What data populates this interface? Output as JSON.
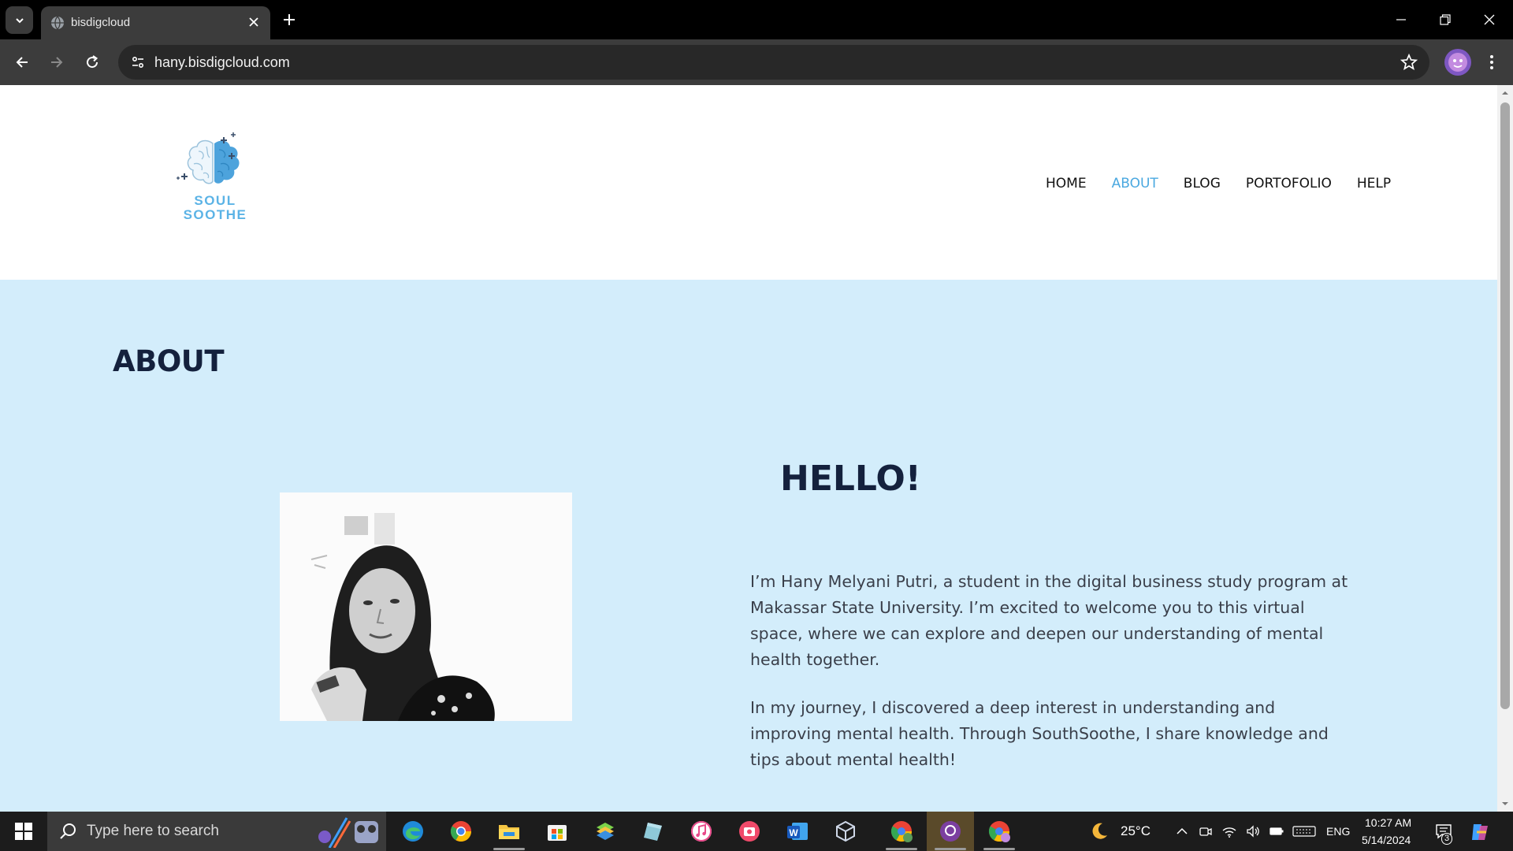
{
  "browser": {
    "tab_title": "bisdigcloud",
    "url": "hany.bisdigcloud.com"
  },
  "site": {
    "logo_line1": "SOUL",
    "logo_line2": "SOOTHE",
    "nav": [
      {
        "label": "HOME",
        "active": false
      },
      {
        "label": "ABOUT",
        "active": true
      },
      {
        "label": "BLOG",
        "active": false
      },
      {
        "label": "PORTOFOLIO",
        "active": false
      },
      {
        "label": "HELP",
        "active": false
      }
    ],
    "accent_color": "#4aa8e0",
    "section_bg": "#d3edfb"
  },
  "about": {
    "heading": "ABOUT",
    "hello": "HELLO!",
    "paragraph1": "I’m Hany Melyani Putri, a student in the digital business study program at Makassar State University. I’m excited to welcome you to this virtual space, where we can explore and deepen our understanding of mental health together.",
    "paragraph2": "In my journey, I discovered a deep interest in understanding and improving mental health. Through SouthSoothe, I share knowledge and tips about mental health!"
  },
  "taskbar": {
    "search_placeholder": "Type here to search",
    "weather": "25°C",
    "language": "ENG",
    "time": "10:27 AM",
    "date": "5/14/2024",
    "notification_count": "3",
    "pinned": [
      "edge-icon",
      "chrome-icon",
      "file-explorer-icon",
      "microsoft-store-icon",
      "bluestacks-icon",
      "notes-icon",
      "itunes-icon",
      "camera-icon",
      "word-icon",
      "virtualbox-icon",
      "chrome-profile-icon",
      "github-icon",
      "chrome-active-icon"
    ]
  }
}
